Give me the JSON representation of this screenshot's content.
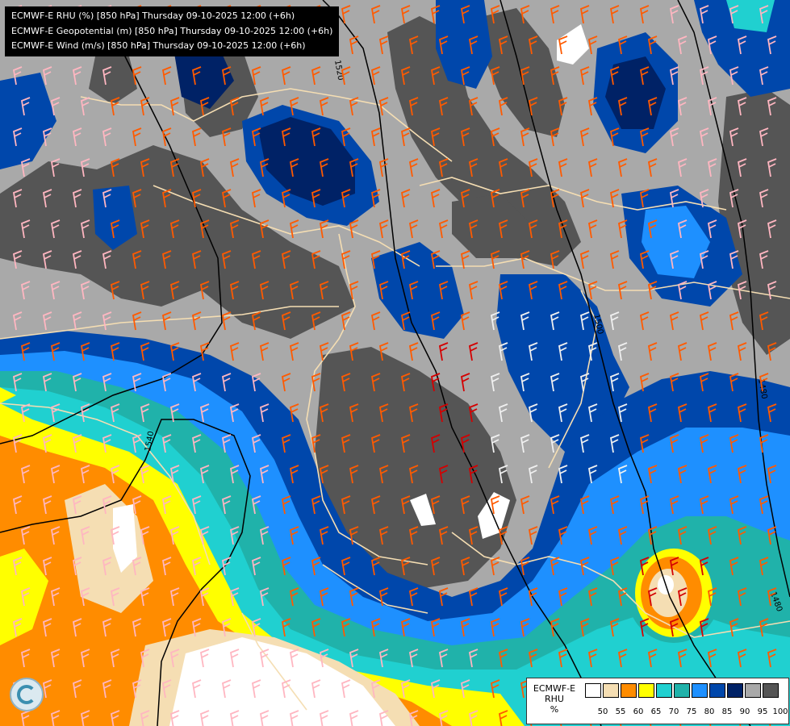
{
  "titles": [
    "ECMWF-E RHU (%) [850 hPa] Thursday 09-10-2025 12:00 (+6h)",
    "ECMWF-E Geopotential (m) [850 hPa] Thursday 09-10-2025 12:00 (+6h)",
    "ECMWF-E Wind (m/s) [850 hPa] Thursday 09-10-2025 12:00 (+6h)"
  ],
  "legend": {
    "line1": "ECMWF-E",
    "line2": "RHU",
    "line3": "%",
    "classes": [
      {
        "label": "50",
        "color": "#ffffff"
      },
      {
        "label": "55",
        "color": "#f5deb3"
      },
      {
        "label": "60",
        "color": "#ff8c00"
      },
      {
        "label": "65",
        "color": "#ffff00"
      },
      {
        "label": "70",
        "color": "#20d0d0"
      },
      {
        "label": "75",
        "color": "#20b2aa"
      },
      {
        "label": "80",
        "color": "#1e90ff"
      },
      {
        "label": "85",
        "color": "#0047ab"
      },
      {
        "label": "90",
        "color": "#002266"
      },
      {
        "label": "95",
        "color": "#a9a9a9"
      },
      {
        "label": "100",
        "color": "#555555"
      }
    ]
  },
  "geopotential_labels": [
    "1520",
    "1540",
    "1500",
    "1480",
    "1480"
  ],
  "colors": {
    "wind_strong": "#ff5a00",
    "wind_very_strong": "#d40000",
    "wind_light": "#ffb6c1",
    "borders": "#f5deb3",
    "contours": "#000000"
  },
  "logo": "ecmwf-logo"
}
